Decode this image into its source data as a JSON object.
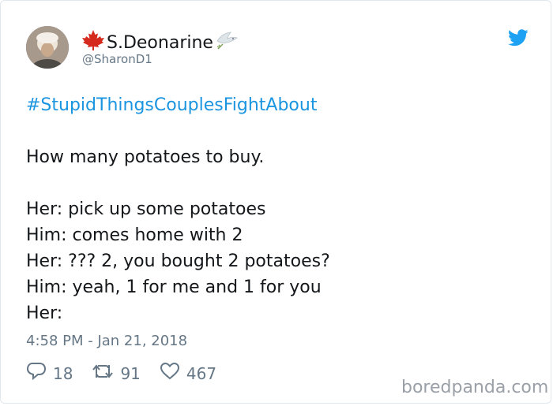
{
  "tweet": {
    "display_name": "S.Deonarine",
    "handle": "@SharonD1",
    "hashtag": "#StupidThingsCouplesFightAbout",
    "lines": [
      "How many potatoes to buy.",
      "Her: pick up some potatoes",
      "Him: comes home with 2",
      "Her: ??? 2, you bought 2 potatoes?",
      "Him: yeah, 1 for me and 1 for you",
      "Her:"
    ],
    "timestamp": "4:58 PM - Jan 21, 2018",
    "reply_count": "18",
    "retweet_count": "91",
    "like_count": "467"
  },
  "watermark": "boredpanda.com",
  "icons": {
    "name_prefix": "maple-leaf-icon",
    "name_suffix": "dove-icon",
    "brand": "twitter-bird-icon",
    "reply": "reply-icon",
    "retweet": "retweet-icon",
    "like": "heart-icon"
  },
  "colors": {
    "hashtag": "#1b95e0",
    "twitter_blue": "#1da1f2",
    "maple_red": "#d52b1e",
    "muted": "#657786"
  }
}
